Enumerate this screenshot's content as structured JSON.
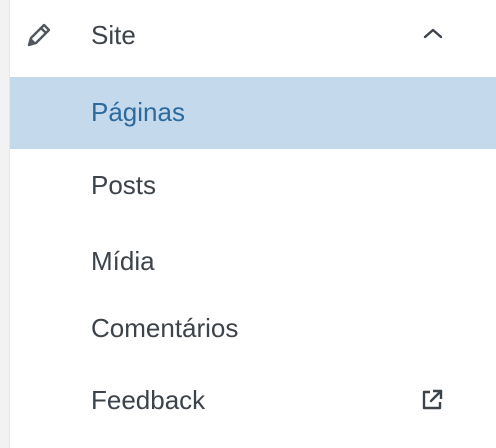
{
  "section": {
    "title": "Site",
    "icon": "pencil-icon",
    "toggle_icon": "chevron-up-icon"
  },
  "menu": {
    "items": [
      {
        "label": "Páginas",
        "active": true
      },
      {
        "label": "Posts",
        "active": false
      },
      {
        "label": "Mídia",
        "active": false
      },
      {
        "label": "Comentários",
        "active": false
      },
      {
        "label": "Feedback",
        "active": false,
        "icon": "external-link-icon"
      }
    ]
  },
  "colors": {
    "active_background": "#c5d9ed",
    "active_text": "#2c6a9e",
    "text": "#3c434a"
  }
}
